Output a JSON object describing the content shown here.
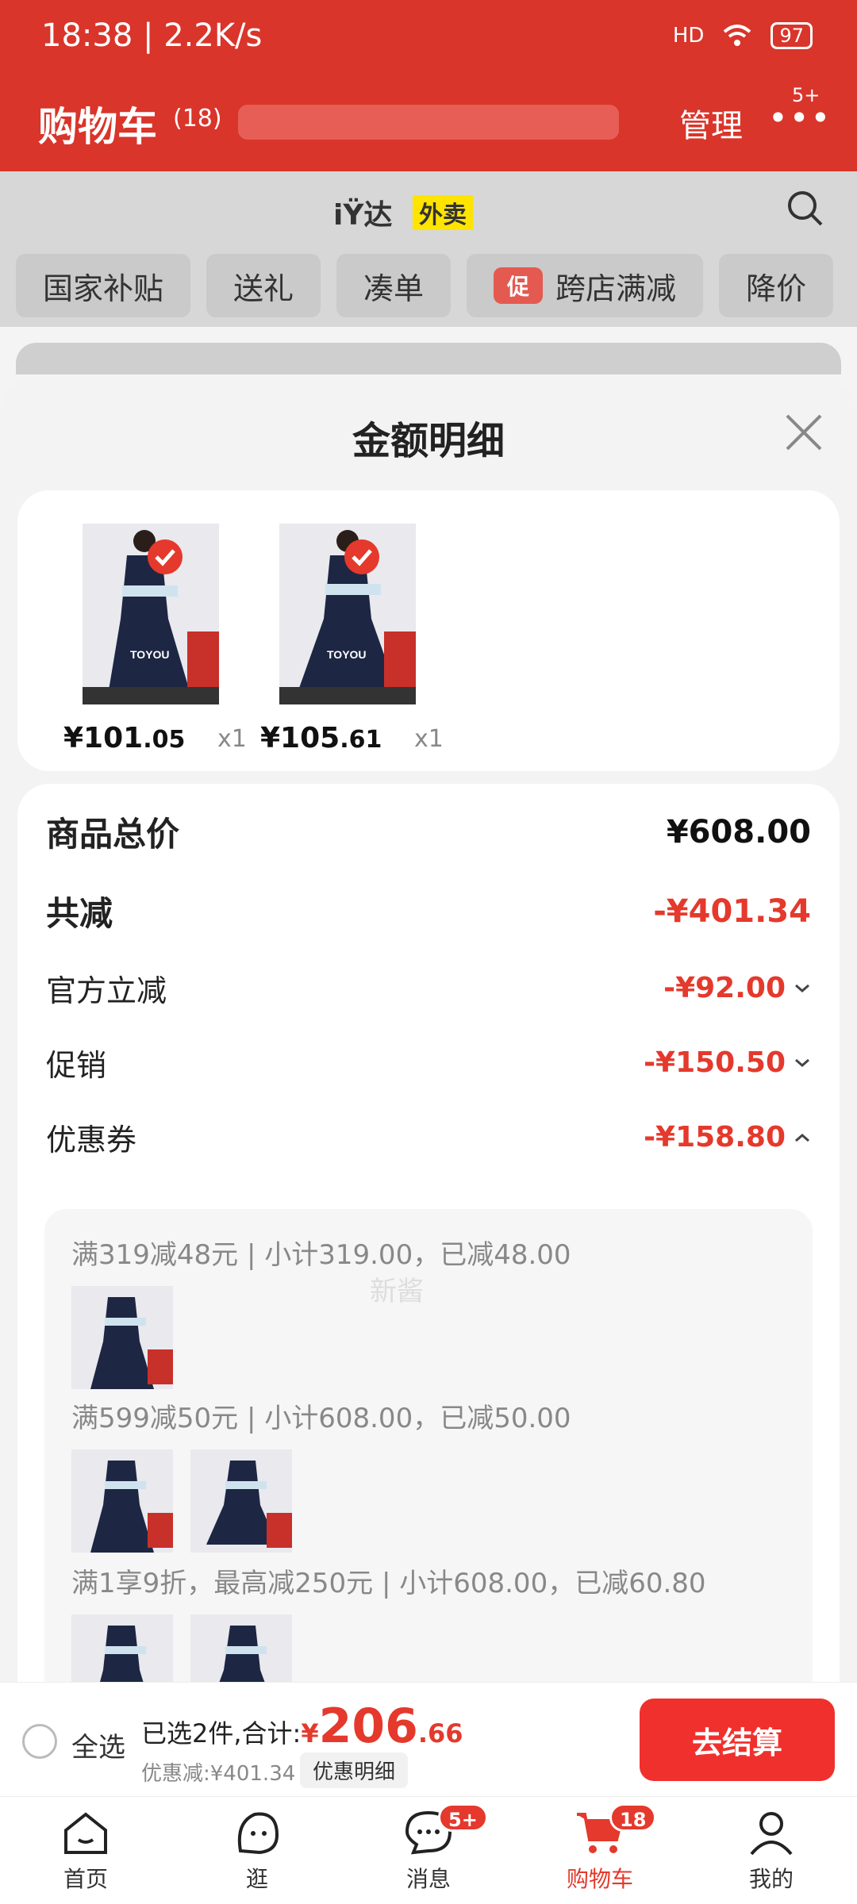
{
  "status_bar": {
    "time": "18:38",
    "net_speed": "2.2K/s",
    "signal": "HD",
    "battery": "97"
  },
  "header": {
    "title": "购物车",
    "count": "(18)",
    "manage": "管理",
    "more_badge": "5+"
  },
  "search": {
    "mark": "iŸ达",
    "tag": "外卖"
  },
  "filters": [
    {
      "label": "国家补贴"
    },
    {
      "label": "送礼"
    },
    {
      "label": "凑单"
    },
    {
      "label": "跨店满减",
      "promo": "促"
    },
    {
      "label": "降价"
    }
  ],
  "sheet": {
    "title": "金额明细"
  },
  "items": [
    {
      "price_int": "¥101",
      "price_dec": ".05",
      "qty": "x1",
      "brand": "TOYOU"
    },
    {
      "price_int": "¥105",
      "price_dec": ".61",
      "qty": "x1",
      "brand": "TOYOU"
    }
  ],
  "summary": {
    "total_label": "商品总价",
    "total_value": "¥608.00",
    "reduce_label": "共减",
    "reduce_value": "-¥401.34",
    "official_label": "官方立减",
    "official_value": "-¥92.00",
    "promo_label": "促销",
    "promo_value": "-¥150.50",
    "coupon_label": "优惠券",
    "coupon_value": "-¥158.80"
  },
  "coupons": [
    {
      "title": "满319减48元 | 小计319.00，已减48.00"
    },
    {
      "title": "满599减50元 | 小计608.00，已减50.00"
    },
    {
      "title": "满1享9折，最高减250元 | 小计608.00，已减60.80"
    }
  ],
  "watermark": "新酱",
  "bottom": {
    "select_all": "全选",
    "selected_text": "已选2件,合计:",
    "currency": "¥",
    "total_int": "206",
    "total_dec": ".66",
    "discount_text": "优惠减:¥401.34",
    "discount_button": "优惠明细",
    "checkout": "去结算"
  },
  "tabs": [
    {
      "label": "首页",
      "icon": "home-icon"
    },
    {
      "label": "逛",
      "icon": "browse-icon"
    },
    {
      "label": "消息",
      "icon": "message-icon",
      "badge": "5+"
    },
    {
      "label": "购物车",
      "icon": "cart-icon",
      "badge": "18"
    },
    {
      "label": "我的",
      "icon": "profile-icon"
    }
  ],
  "colors": {
    "brand": "#d9352b",
    "accent": "#e4392c",
    "checkout": "#f0302d"
  }
}
